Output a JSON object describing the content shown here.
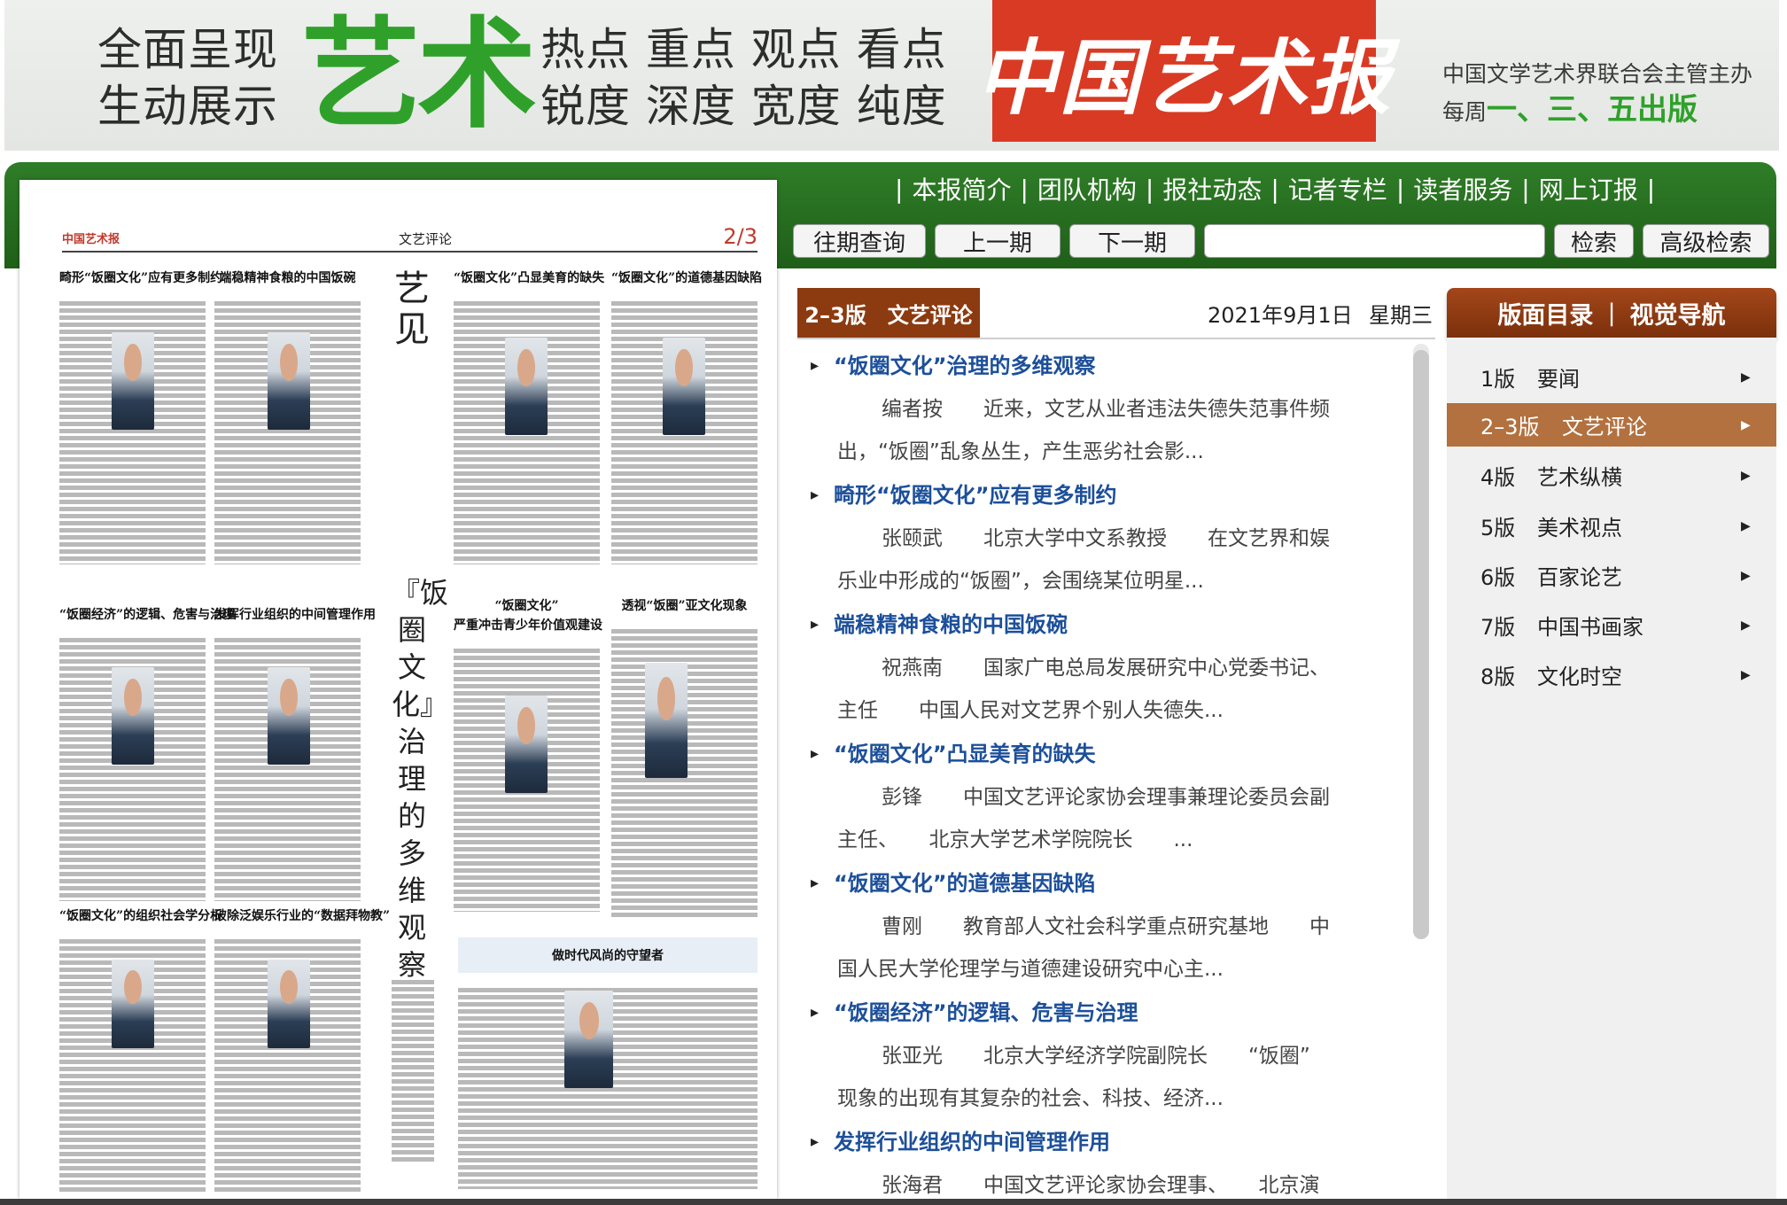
{
  "banner": {
    "slogan_left": [
      "全面呈现",
      "生动展示"
    ],
    "art_word": "艺术",
    "slogan_right": [
      "热点 重点 观点 看点",
      "锐度 深度 宽度 纯度"
    ],
    "logo": "中国艺术报",
    "publisher": "中国文学艺术界联合会主管主办",
    "schedule_prefix": "每周",
    "schedule_days": "一、三、五出版"
  },
  "nav": {
    "links": [
      "本报简介",
      "团队机构",
      "报社动态",
      "记者专栏",
      "读者服务",
      "网上订报"
    ],
    "separator": "|"
  },
  "search": {
    "past_issues": "往期查询",
    "prev_issue": "上一期",
    "next_issue": "下一期",
    "query_value": "",
    "search_button": "检索",
    "advanced_search": "高级检索"
  },
  "paper": {
    "masthead": "中国艺术报",
    "section": "文艺评论",
    "page_no": "2/3",
    "headings": [
      "畸形“饭圈文化”应有更多制约",
      "端稳精神食粮的中国饭碗",
      "“饭圈文化”凸显美育的缺失",
      "“饭圈文化”的道德基因缺陷",
      "“饭圈经济”的逻辑、危害与治理",
      "发挥行业组织的中间管理作用",
      "“饭圈文化”",
      "严重冲击青少年价值观建设",
      "透视“饭圈”亚文化现象",
      "“饭圈文化”的组织社会学分析",
      "破除泛娱乐行业的“数据拜物教”",
      "做时代风尚的守望者"
    ],
    "column_label": "艺见",
    "vertical_title": "『饭圈文化』治理的多维观察"
  },
  "section_tab": "2–3版　文艺评论",
  "issue_date": "2021年9月1日",
  "issue_weekday": "星期三",
  "articles": [
    {
      "title": "“饭圈文化”治理的多维观察",
      "lines": [
        "编者按　　近来，文艺从业者违法失德失范事件频",
        "出，“饭圈”乱象丛生，产生恶劣社会影..."
      ]
    },
    {
      "title": "畸形“饭圈文化”应有更多制约",
      "lines": [
        "张颐武　　北京大学中文系教授　　在文艺界和娱",
        "乐业中形成的“饭圈”，会围绕某位明星..."
      ]
    },
    {
      "title": "端稳精神食粮的中国饭碗",
      "lines": [
        "祝燕南　　国家广电总局发展研究中心党委书记、",
        "主任　　中国人民对文艺界个别人失德失..."
      ]
    },
    {
      "title": "“饭圈文化”凸显美育的缺失",
      "lines": [
        "彭锋　　中国文艺评论家协会理事兼理论委员会副",
        "主任、　　北京大学艺术学院院长　　..."
      ]
    },
    {
      "title": "“饭圈文化”的道德基因缺陷",
      "lines": [
        "曹刚　　教育部人文社会科学重点研究基地　　中",
        "国人民大学伦理学与道德建设研究中心主..."
      ]
    },
    {
      "title": "“饭圈经济”的逻辑、危害与治理",
      "lines": [
        "张亚光　　北京大学经济学院副院长　　“饭圈”",
        "现象的出现有其复杂的社会、科技、经济..."
      ]
    },
    {
      "title": "发挥行业组织的中间管理作用",
      "lines": [
        "张海君　　中国文艺评论家协会理事、　　北京演"
      ]
    }
  ],
  "directory": {
    "header_left": "版面目录",
    "header_sep": "|",
    "header_right": "视觉导航",
    "arrow": "▶",
    "items": [
      {
        "num": "1版",
        "name": "要闻",
        "active": false
      },
      {
        "num": "2–3版",
        "name": "文艺评论",
        "active": true
      },
      {
        "num": "4版",
        "name": "艺术纵横",
        "active": false
      },
      {
        "num": "5版",
        "name": "美术视点",
        "active": false
      },
      {
        "num": "6版",
        "name": "百家论艺",
        "active": false
      },
      {
        "num": "7版",
        "name": "中国书画家",
        "active": false
      },
      {
        "num": "8版",
        "name": "文化时空",
        "active": false
      }
    ]
  },
  "colors": {
    "nav_green": "#2f7d28",
    "logo_red": "#d93a24",
    "tab_brown": "#8c3a10",
    "active_brown": "#b2713f",
    "link_blue": "#1c4f9a"
  }
}
